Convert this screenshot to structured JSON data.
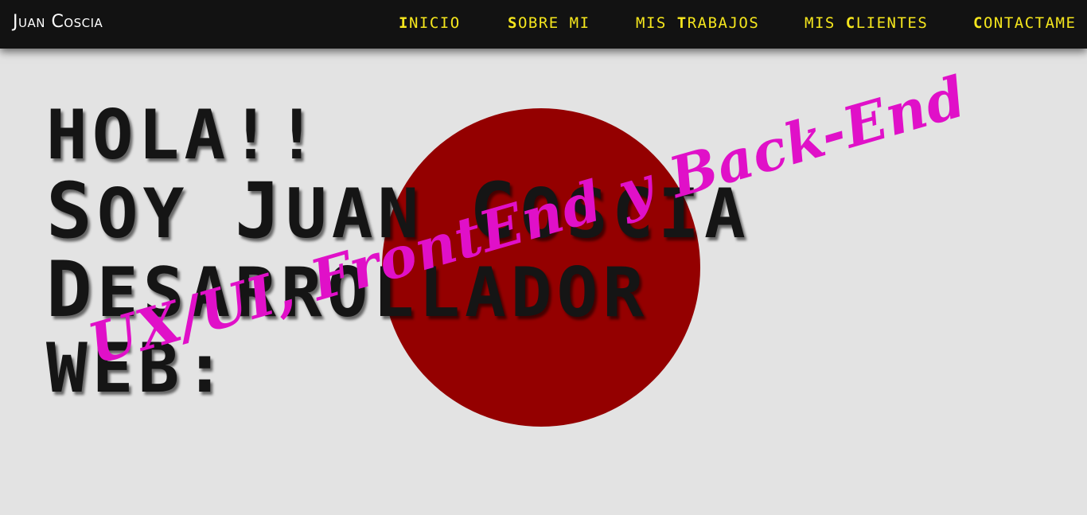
{
  "brand": {
    "name": "Juan Coscia"
  },
  "nav": {
    "items": [
      {
        "cap": "I",
        "rest": "NICIO"
      },
      {
        "cap": "S",
        "rest": "OBRE MI"
      },
      {
        "cap": "T",
        "pre": "MIS ",
        "rest": "RABAJOS"
      },
      {
        "cap": "C",
        "pre": "MIS ",
        "rest": "LIENTES"
      },
      {
        "cap": "C",
        "rest": "ONTACTAME"
      }
    ]
  },
  "hero": {
    "line1": "Hola!!",
    "line2_cap1": "S",
    "line2_a": "oy ",
    "line2_cap2": "J",
    "line2_b": "uan ",
    "line2_cap3": "C",
    "line2_c": "oscia",
    "line3_cap": "D",
    "line3_rest": "esarrollador",
    "line4": "Web:",
    "tagline": "UX/UI, FrontEnd y Back-End"
  },
  "colors": {
    "navbar_bg": "#121212",
    "nav_accent": "#f5e61d",
    "page_bg": "#e3e3e3",
    "sun": "#940000",
    "headline": "#151515",
    "tagline": "#e010c8"
  }
}
